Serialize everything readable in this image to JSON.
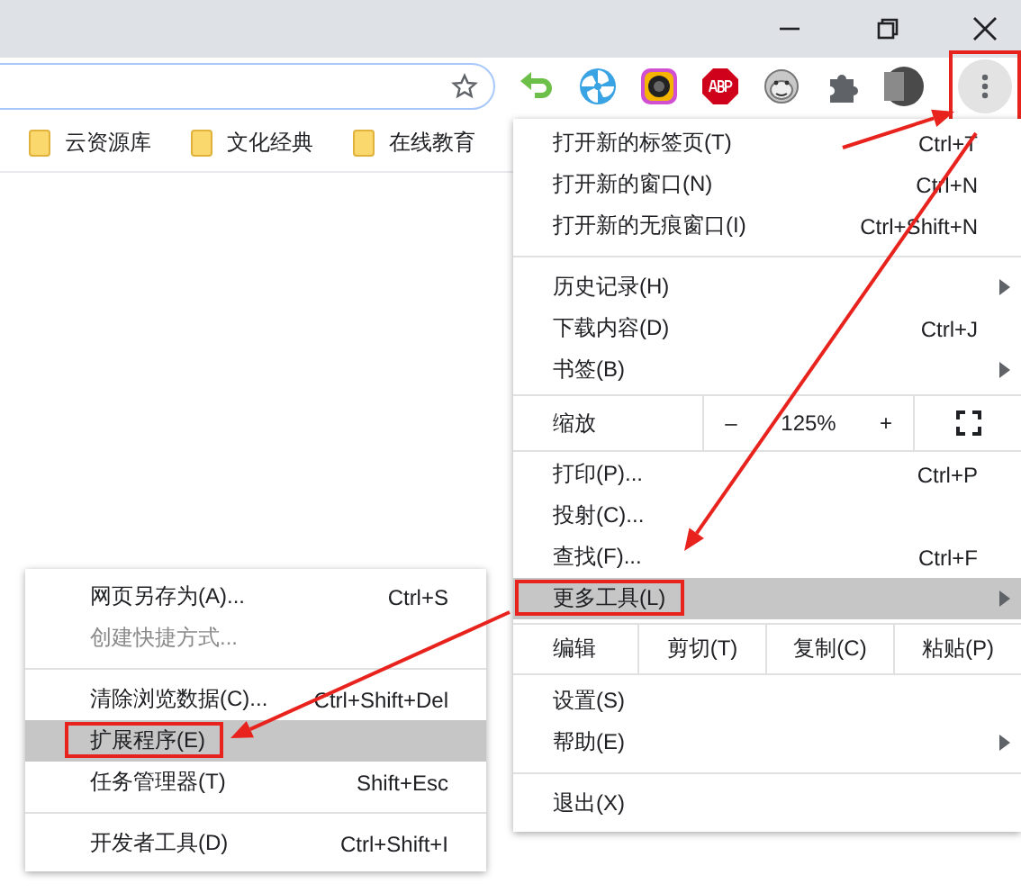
{
  "toolbar": {
    "menu_button_annotated": true
  },
  "bookmarks": [
    {
      "label": "云资源库"
    },
    {
      "label": "文化经典"
    },
    {
      "label": "在线教育"
    }
  ],
  "menu": {
    "items": [
      {
        "kind": "item",
        "label": "打开新的标签页(T)",
        "shortcut": "Ctrl+T",
        "has_submenu": false,
        "selected": false,
        "disabled": false,
        "annotated": false
      },
      {
        "kind": "item",
        "label": "打开新的窗口(N)",
        "shortcut": "Ctrl+N",
        "has_submenu": false,
        "selected": false,
        "disabled": false,
        "annotated": false
      },
      {
        "kind": "item",
        "label": "打开新的无痕窗口(I)",
        "shortcut": "Ctrl+Shift+N",
        "has_submenu": false,
        "selected": false,
        "disabled": false,
        "annotated": false
      },
      {
        "kind": "separator"
      },
      {
        "kind": "item",
        "label": "历史记录(H)",
        "has_submenu": true,
        "selected": false,
        "disabled": false,
        "annotated": false
      },
      {
        "kind": "item",
        "label": "下载内容(D)",
        "shortcut": "Ctrl+J",
        "has_submenu": false,
        "selected": false,
        "disabled": false,
        "annotated": false
      },
      {
        "kind": "item",
        "label": "书签(B)",
        "has_submenu": true,
        "selected": false,
        "disabled": false,
        "annotated": false
      },
      {
        "kind": "zoom",
        "label": "缩放",
        "minus": "–",
        "value": "125%",
        "plus": "+"
      },
      {
        "kind": "item",
        "label": "打印(P)...",
        "shortcut": "Ctrl+P",
        "has_submenu": false,
        "selected": false,
        "disabled": false,
        "annotated": false
      },
      {
        "kind": "item",
        "label": "投射(C)...",
        "has_submenu": false,
        "selected": false,
        "disabled": false,
        "annotated": false
      },
      {
        "kind": "item",
        "label": "查找(F)...",
        "shortcut": "Ctrl+F",
        "has_submenu": false,
        "selected": false,
        "disabled": false,
        "annotated": false
      },
      {
        "kind": "item",
        "label": "更多工具(L)",
        "has_submenu": true,
        "selected": true,
        "disabled": false,
        "annotated": true
      },
      {
        "kind": "edit",
        "label": "编辑",
        "buttons": [
          "剪切(T)",
          "复制(C)",
          "粘贴(P)"
        ]
      },
      {
        "kind": "item",
        "label": "设置(S)",
        "has_submenu": false,
        "selected": false,
        "disabled": false,
        "annotated": false
      },
      {
        "kind": "item",
        "label": "帮助(E)",
        "has_submenu": true,
        "selected": false,
        "disabled": false,
        "annotated": false
      },
      {
        "kind": "separator"
      },
      {
        "kind": "item",
        "label": "退出(X)",
        "has_submenu": false,
        "selected": false,
        "disabled": false,
        "annotated": false
      }
    ]
  },
  "submenu": {
    "items": [
      {
        "kind": "item",
        "label": "网页另存为(A)...",
        "shortcut": "Ctrl+S",
        "has_submenu": false,
        "selected": false,
        "disabled": false,
        "annotated": false
      },
      {
        "kind": "item",
        "label": "创建快捷方式...",
        "has_submenu": false,
        "selected": false,
        "disabled": true,
        "annotated": false
      },
      {
        "kind": "separator"
      },
      {
        "kind": "item",
        "label": "清除浏览数据(C)...",
        "shortcut": "Ctrl+Shift+Del",
        "has_submenu": false,
        "selected": false,
        "disabled": false,
        "annotated": false
      },
      {
        "kind": "item",
        "label": "扩展程序(E)",
        "has_submenu": false,
        "selected": true,
        "disabled": false,
        "annotated": true
      },
      {
        "kind": "item",
        "label": "任务管理器(T)",
        "shortcut": "Shift+Esc",
        "has_submenu": false,
        "selected": false,
        "disabled": false,
        "annotated": false
      },
      {
        "kind": "separator"
      },
      {
        "kind": "item",
        "label": "开发者工具(D)",
        "shortcut": "Ctrl+Shift+I",
        "has_submenu": false,
        "selected": false,
        "disabled": false,
        "annotated": false
      }
    ]
  }
}
